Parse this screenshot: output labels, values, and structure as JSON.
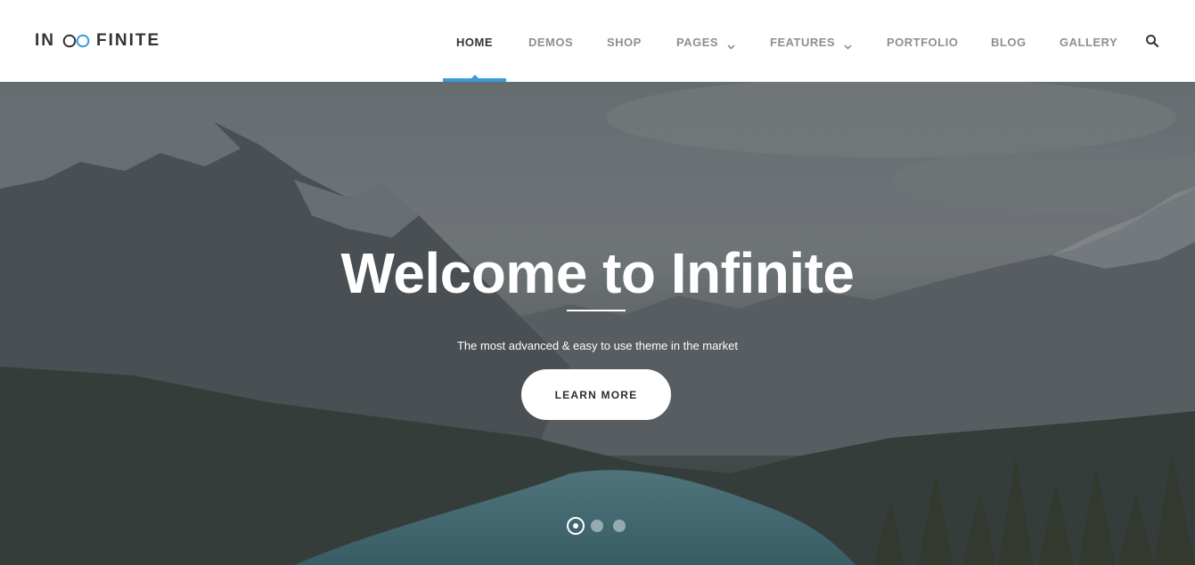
{
  "brand": {
    "logo_left": "IN",
    "logo_right": "FINITE",
    "accent_color": "#3d9ad9"
  },
  "nav": {
    "items": [
      {
        "label": "HOME",
        "active": true,
        "has_dropdown": false
      },
      {
        "label": "DEMOS",
        "active": false,
        "has_dropdown": false
      },
      {
        "label": "SHOP",
        "active": false,
        "has_dropdown": false
      },
      {
        "label": "PAGES",
        "active": false,
        "has_dropdown": true
      },
      {
        "label": "FEATURES",
        "active": false,
        "has_dropdown": true
      },
      {
        "label": "PORTFOLIO",
        "active": false,
        "has_dropdown": false
      },
      {
        "label": "BLOG",
        "active": false,
        "has_dropdown": false
      },
      {
        "label": "GALLERY",
        "active": false,
        "has_dropdown": false
      }
    ],
    "search_icon": "search-icon"
  },
  "hero": {
    "title": "Welcome to Infinite",
    "subtitle": "The most advanced & easy to use theme in the market",
    "button_label": "LEARN MORE",
    "slide_count": 3,
    "active_slide": 1
  }
}
